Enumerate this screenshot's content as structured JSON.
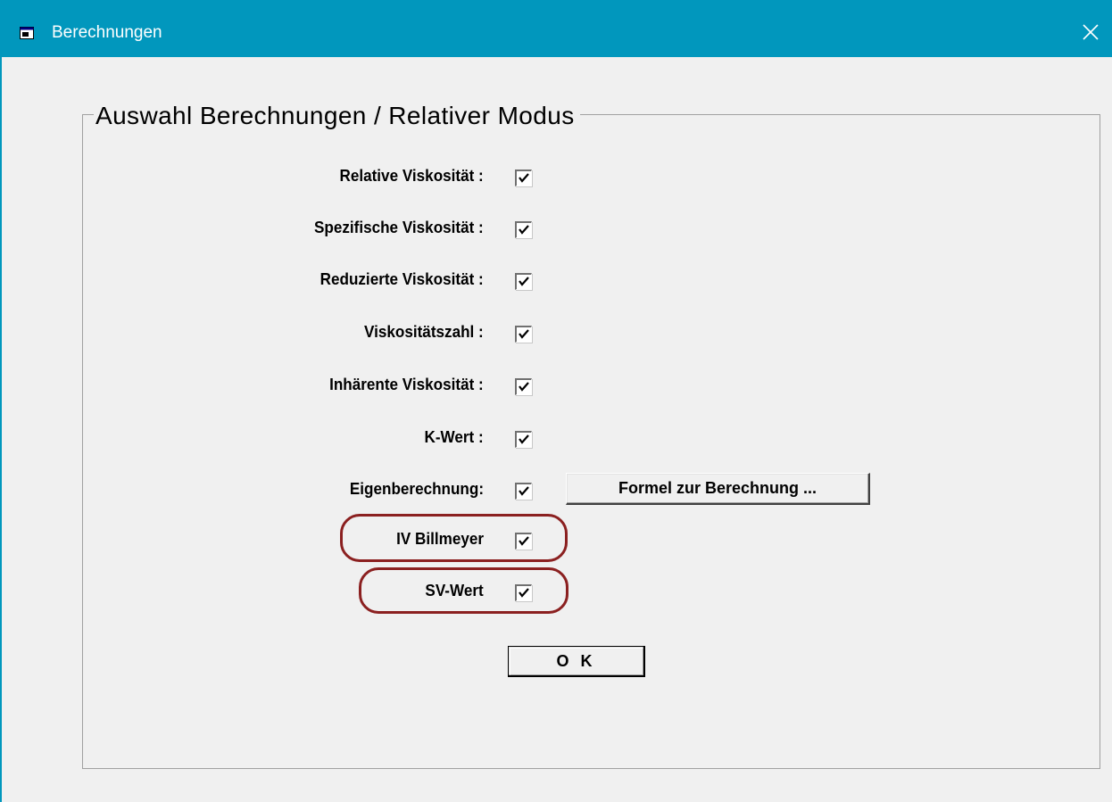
{
  "window": {
    "title": "Berechnungen",
    "accent_color": "#0197bd",
    "highlight_color": "#8b2020"
  },
  "group": {
    "legend": "Auswahl Berechnungen / Relativer Modus"
  },
  "rows": [
    {
      "label": "Relative Viskosität :",
      "checked": true
    },
    {
      "label": "Spezifische Viskosität :",
      "checked": true
    },
    {
      "label": "Reduzierte Viskosität :",
      "checked": true
    },
    {
      "label": "Viskositätszahl :",
      "checked": true
    },
    {
      "label": "Inhärente Viskosität :",
      "checked": true
    },
    {
      "label": "K-Wert :",
      "checked": true
    },
    {
      "label": "Eigenberechnung:",
      "checked": true
    },
    {
      "label": "IV Billmeyer",
      "checked": true
    },
    {
      "label": "SV-Wert",
      "checked": true
    }
  ],
  "buttons": {
    "formel_label": "Formel zur Berechnung ...",
    "ok_label": "O K"
  }
}
